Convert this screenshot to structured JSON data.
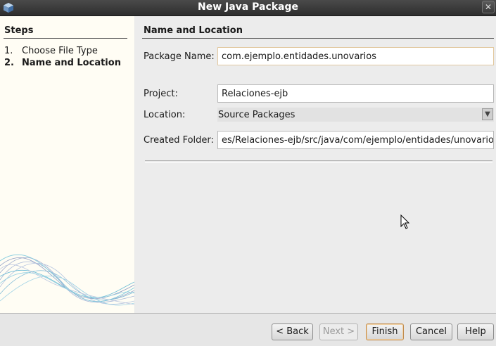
{
  "window": {
    "title": "New Java Package",
    "close_glyph": "✕",
    "icon": "cube-icon"
  },
  "steps": {
    "heading": "Steps",
    "items": [
      {
        "num": "1.",
        "label": "Choose File Type"
      },
      {
        "num": "2.",
        "label": "Name and Location"
      }
    ]
  },
  "main": {
    "heading": "Name and Location",
    "package_name": {
      "label": "Package Name:",
      "value": "com.ejemplo.entidades.unovarios"
    },
    "project": {
      "label": "Project:",
      "value": "Relaciones-ejb"
    },
    "location": {
      "label": "Location:",
      "value": "Source Packages",
      "arrow": "▼"
    },
    "created_folder": {
      "label": "Created Folder:",
      "value": "es/Relaciones-ejb/src/java/com/ejemplo/entidades/unovarios"
    }
  },
  "buttons": {
    "back": "< Back",
    "next": "Next >",
    "finish": "Finish",
    "cancel": "Cancel",
    "help": "Help"
  }
}
